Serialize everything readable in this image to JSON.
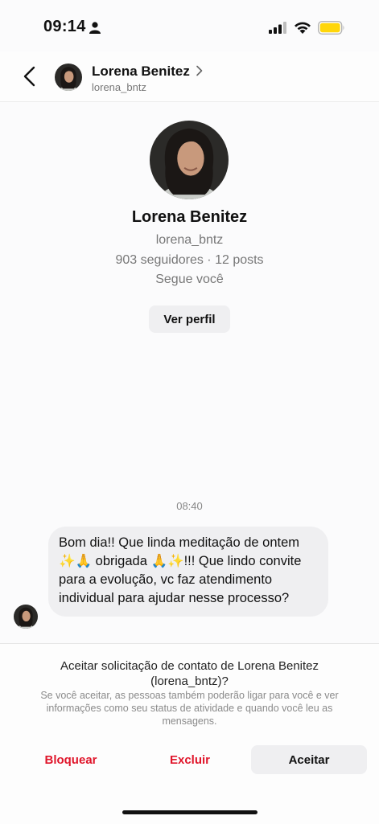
{
  "status": {
    "time": "09:14"
  },
  "header": {
    "name": "Lorena Benitez",
    "username": "lorena_bntz"
  },
  "profile": {
    "name": "Lorena Benitez",
    "username": "lorena_bntz",
    "stats": "903 seguidores · 12 posts",
    "follows_you": "Segue você",
    "view_profile_label": "Ver perfil"
  },
  "chat": {
    "timestamp": "08:40",
    "message": "Bom dia!! Que linda meditação de ontem ✨🙏 obrigada 🙏✨!!! Que lindo convite para a evolução, vc faz atendimento individual para ajudar nesse processo?"
  },
  "request": {
    "title": "Aceitar solicitação de contato de Lorena Benitez (lorena_bntz)?",
    "subtitle": "Se você aceitar, as pessoas também poderão ligar para você e ver informações como seu status de atividade e quando você leu as mensagens.",
    "block_label": "Bloquear",
    "delete_label": "Excluir",
    "accept_label": "Aceitar"
  },
  "colors": {
    "danger": "#e0162b",
    "battery": "#ffd60a",
    "button_bg": "#efeff1"
  },
  "icons": [
    "person-icon",
    "signal-icon",
    "wifi-icon",
    "battery-icon",
    "back-chevron-icon",
    "chevron-right-icon"
  ]
}
